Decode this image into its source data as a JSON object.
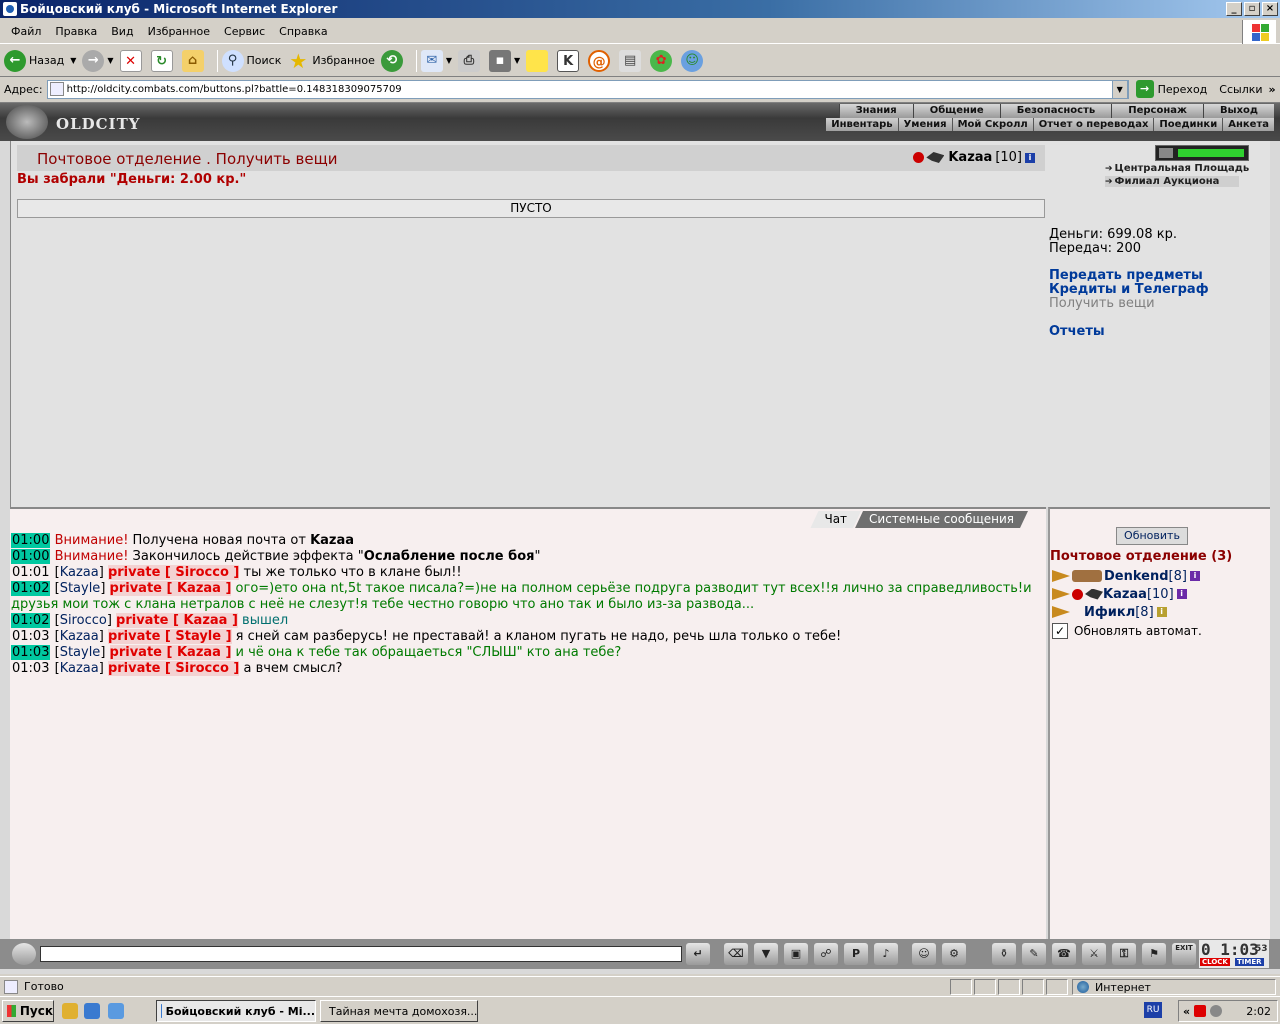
{
  "window": {
    "title": "Бойцовский клуб - Microsoft Internet Explorer",
    "buttons": [
      "_",
      "▫",
      "×"
    ]
  },
  "menu": [
    "Файл",
    "Правка",
    "Вид",
    "Избранное",
    "Сервис",
    "Справка"
  ],
  "toolbar": {
    "back_label": "Назад",
    "search_label": "Поиск",
    "favorites_label": "Избранное"
  },
  "address": {
    "label": "Адрес:",
    "url": "http://oldcity.combats.com/buttons.pl?battle=0.148318309075709",
    "go_label": "Переход",
    "links_label": "Ссылки"
  },
  "game": {
    "logo": "OLDCITY",
    "nav_top": [
      "Знания",
      "Общение",
      "Безопасность",
      "Персонаж",
      "Выход"
    ],
    "nav_bottom": [
      "Инвентарь",
      "Умения",
      "Мой Скролл",
      "Отчет о переводах",
      "Поединки",
      "Анкета"
    ],
    "hp_fraction": 1.0
  },
  "post": {
    "title": "Почтовое отделение .  Получить вещи",
    "character": "Kazaa",
    "character_level": "[10]",
    "took_message": "Вы забрали \"Деньги: 2.00 кр.\"",
    "empty_label": "ПУСТО"
  },
  "right": {
    "locations": [
      "Центральная Площадь",
      "Филиал Аукциона"
    ],
    "money": "Деньги: 699.08 кр.",
    "transfers": "Передач: 200",
    "links": [
      "Передать предметы",
      "Кредиты и Телеграф"
    ],
    "current_link": "Получить вещи",
    "reports_link": "Отчеты"
  },
  "chat": {
    "tab_chat": "Чат",
    "tab_system": "Системные сообщения",
    "messages": [
      {
        "ts": "01:00",
        "hl": true,
        "warn": "Внимание!",
        "text": " Получена новая почта от ",
        "bold": "Kazaa"
      },
      {
        "ts": "01:00",
        "hl": true,
        "warn": "Внимание!",
        "text": " Закончилось действие эффекта \"",
        "bold": "Ослабление после боя",
        "tail": "\""
      },
      {
        "ts": "01:01",
        "hl": false,
        "nick": "Kazaa",
        "priv": "private [ Sirocco ]",
        "text": " ты же только что в клане был!!"
      },
      {
        "ts": "01:02",
        "hl": true,
        "nick": "Stayle",
        "priv": "private [ Kazaa ]",
        "text": " ого=)ето она nt,5t такое писала?=)не на полном серьёзе подруга разводит тут всех!!я лично за справедливость!и друзья мои тож с клана нетралов с неё не слезут!я тебе честно говорю что ано так и было из-за развода...",
        "green": true
      },
      {
        "ts": "01:02",
        "hl": true,
        "nick": "Sirocco",
        "priv": "private [ Kazaa ]",
        "text": " вышел",
        "teal": true
      },
      {
        "ts": "01:03",
        "hl": false,
        "nick": "Kazaa",
        "priv": "private [ Stayle ]",
        "text": " я сней сам разберусь! не преставай! а кланом пугать не надо, речь шла только о тебе!"
      },
      {
        "ts": "01:03",
        "hl": true,
        "nick": "Stayle",
        "priv": "private [ Kazaa ]",
        "text": " и чё она к тебе так обращаеться \"СЛЫШ\" кто ана тебе?",
        "green": true
      },
      {
        "ts": "01:03",
        "hl": false,
        "nick": "Kazaa",
        "priv": "private [ Sirocco ]",
        "text": " а вчем смысл?"
      }
    ]
  },
  "side": {
    "refresh_label": "Обновить",
    "room_title": "Почтовое отделение (3)",
    "users": [
      {
        "name": "Denkend",
        "level": "[8]"
      },
      {
        "name": "Kazaa",
        "level": "[10]"
      },
      {
        "name": "Ификл",
        "level": "[8]"
      }
    ],
    "auto_label": "Обновлять автомат.",
    "auto_check": "✓"
  },
  "inputbar": {
    "clock_time": "0 1:03",
    "clock_seconds": "53",
    "clock_label": "CLOCK",
    "timer_label": "TIMER",
    "exit_label": "EXIT"
  },
  "status": {
    "text": "Готово",
    "zone": "Интернет"
  },
  "taskbar": {
    "start": "Пуск",
    "tasks": [
      "Бойцовский клуб - Mi...",
      "Тайная мечта домохозя..."
    ],
    "lang": "RU",
    "time": "2:02",
    "chevron": "«"
  },
  "colors": {
    "title_red": "#8b0000",
    "link_blue": "#003a9a",
    "private_red": "#e00000",
    "timestamp_highlight": "#00c8a0"
  }
}
